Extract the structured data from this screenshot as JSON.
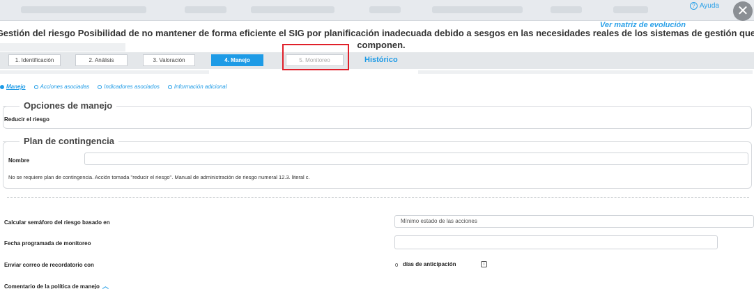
{
  "header": {
    "help_label": "Ayuda",
    "help_icon": "question-circle-icon",
    "close_icon": "close-icon",
    "close_glyph": "✕",
    "evolution_link": "Ver matriz de evolución"
  },
  "risk": {
    "title": "Gestión del riesgo Posibilidad de no mantener de forma eficiente el SIG por planificación inadecuada debido a sesgos en las necesidades reales de los sistemas de gestión que lo componen."
  },
  "wizard": {
    "steps": [
      {
        "label": "1. Identificación"
      },
      {
        "label": "2. Análisis"
      },
      {
        "label": "3. Valoración"
      },
      {
        "label": "4. Manejo"
      },
      {
        "label": "5. Monitoreo"
      }
    ],
    "history_label": "Histórico"
  },
  "subtabs": [
    {
      "label": "Manejo"
    },
    {
      "label": "Acciones asociadas"
    },
    {
      "label": "Indicadores asociados"
    },
    {
      "label": "Información adicional"
    }
  ],
  "options": {
    "legend": "Opciones de manejo",
    "value": "Reducir el riesgo"
  },
  "contingency": {
    "legend": "Plan de contingencia",
    "name_label": "Nombre",
    "name_value": "",
    "note": "No se requiere plan de contingencia. Acción tomada \"reducir el riesgo\". Manual de administración de riesgo numeral 12.3. literal c."
  },
  "form": {
    "semaphore_label": "Calcular semáforo del riesgo basado en",
    "semaphore_value": "Mínimo estado de las acciones",
    "monitor_date_label": "Fecha programada de monitoreo",
    "monitor_date_value": "",
    "reminder_label": "Enviar correo de recordatorio con",
    "reminder_days": "0",
    "reminder_days_label": "días de anticipación",
    "info_icon": "info-icon",
    "comment_label": "Comentario de la política de manejo",
    "comment_icon": "chevron-up-icon"
  },
  "colors": {
    "accent": "#1e9be6",
    "highlight": "#e0202a",
    "close_bg": "#8b8f94"
  }
}
